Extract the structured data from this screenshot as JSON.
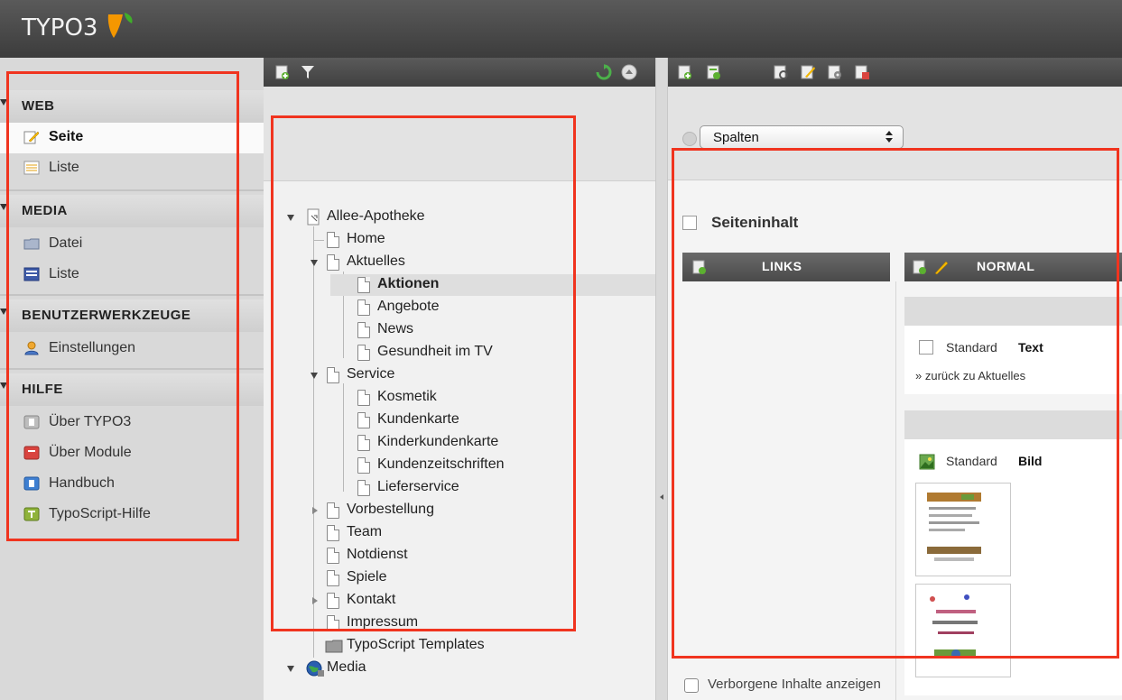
{
  "app": {
    "logo_text": "TYPO3",
    "logo_color": "#f49700"
  },
  "module_menu": {
    "groups": [
      {
        "label": "WEB",
        "items": [
          {
            "label": "Seite",
            "active": true,
            "icon": "page-edit-icon"
          },
          {
            "label": "Liste",
            "active": false,
            "icon": "list-icon"
          }
        ]
      },
      {
        "label": "MEDIA",
        "items": [
          {
            "label": "Datei",
            "icon": "folder-icon"
          },
          {
            "label": "Liste",
            "icon": "media-list-icon"
          }
        ]
      },
      {
        "label": "BENUTZERWERKZEUGE",
        "items": [
          {
            "label": "Einstellungen",
            "icon": "user-settings-icon"
          }
        ]
      },
      {
        "label": "HILFE",
        "items": [
          {
            "label": "Über TYPO3",
            "icon": "about-icon"
          },
          {
            "label": "Über Module",
            "icon": "about-modules-icon"
          },
          {
            "label": "Handbuch",
            "icon": "manual-icon"
          },
          {
            "label": "TypoScript-Hilfe",
            "icon": "typoscript-help-icon"
          }
        ]
      }
    ]
  },
  "page_tree": {
    "root": "Allee-Apotheke",
    "nodes": [
      "Home",
      "Aktuelles",
      "Aktionen",
      "Angebote",
      "News",
      "Gesundheit im TV",
      "Service",
      "Kosmetik",
      "Kundenkarte",
      "Kinderkundenkarte",
      "Kundenzeitschriften",
      "Lieferservice",
      "Vorbestellung",
      "Team",
      "Notdienst",
      "Spiele",
      "Kontakt",
      "Impressum",
      "TypoScript Templates"
    ],
    "media_root": "Media",
    "selected": "Aktionen"
  },
  "content": {
    "view_select": {
      "value": "Spalten"
    },
    "section_title": "Seiteninhalt",
    "columns": [
      {
        "label": "LINKS"
      },
      {
        "label": "NORMAL"
      }
    ],
    "elements": [
      {
        "type_label": "Standard",
        "kind": "Text",
        "link_text": "» zurück zu Aktuelles"
      },
      {
        "type_label": "Standard",
        "kind": "Bild"
      }
    ],
    "show_hidden_label": "Verborgene Inhalte anzeigen"
  }
}
